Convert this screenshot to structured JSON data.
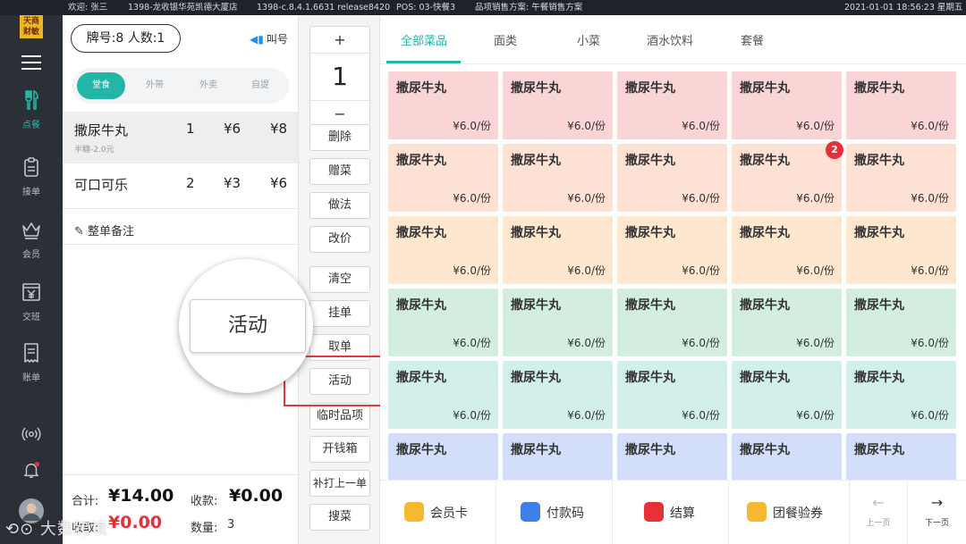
{
  "topbar": {
    "welcome": "欢迎: 张三",
    "store": "1398-龙收银华苑凯德大厦店",
    "version": "1398-c.8.4.1.6631 release8420",
    "pos": "POS: 03-快餐3",
    "plan": "品项销售方案: 午餐销售方案",
    "datetime": "2021-01-01  18:56:23  星期五"
  },
  "brand": {
    "logo_top": "天商",
    "logo_bottom": "财敏"
  },
  "rail": {
    "items": [
      {
        "label": "点餐",
        "icon": "fork-knife-icon",
        "active": true
      },
      {
        "label": "接单",
        "icon": "clipboard-icon",
        "active": false
      },
      {
        "label": "会员",
        "icon": "crown-icon",
        "active": false
      },
      {
        "label": "交班",
        "icon": "yen-register-icon",
        "active": false
      },
      {
        "label": "账单",
        "icon": "bill-icon",
        "active": false
      }
    ]
  },
  "order": {
    "table_info": "牌号:8   人数:1",
    "call_label": "叫号",
    "modes": [
      "堂食",
      "外带",
      "外卖",
      "自提"
    ],
    "selected_mode": "堂食",
    "lines": [
      {
        "name": "撒尿牛丸",
        "qty": "1",
        "price": "¥6",
        "total": "¥8",
        "note": "半糖-2.0元"
      },
      {
        "name": "可口可乐",
        "qty": "2",
        "price": "¥3",
        "total": "¥6",
        "note": ""
      }
    ],
    "whole_note": "整单备注",
    "totals": {
      "sum_label": "合计:",
      "sum_value": "¥14.00",
      "received_label": "收款:",
      "received_value": "¥0.00",
      "due_label": "收取:",
      "due_value": "¥0.00",
      "qty_label": "数量:",
      "qty_value": "3"
    }
  },
  "magnifier": {
    "label": "活动"
  },
  "actions": {
    "plus": "+",
    "quantity": "1",
    "minus": "−",
    "buttons": [
      "删除",
      "赠菜",
      "做法",
      "改价",
      "清空",
      "挂单",
      "取单",
      "活动",
      "临时品项",
      "开钱箱",
      "补打上一单",
      "搜菜"
    ],
    "highlighted": "活动"
  },
  "menu": {
    "tabs": [
      "全部菜品",
      "面类",
      "小菜",
      "酒水饮料",
      "套餐"
    ],
    "selected_tab": "全部菜品",
    "row_colors": [
      "#f9d5d5",
      "#fde1d4",
      "#fde7cf",
      "#d3eedf",
      "#d3efeb",
      "#d3defa"
    ],
    "badge_count": "2",
    "dishes": [
      [
        {
          "name": "撒尿牛丸",
          "price": "¥6.0/份"
        },
        {
          "name": "撒尿牛丸",
          "price": "¥6.0/份"
        },
        {
          "name": "撒尿牛丸",
          "price": "¥6.0/份"
        },
        {
          "name": "撒尿牛丸",
          "price": "¥6.0/份"
        },
        {
          "name": "撒尿牛丸",
          "price": "¥6.0/份"
        }
      ],
      [
        {
          "name": "撒尿牛丸",
          "price": "¥6.0/份"
        },
        {
          "name": "撒尿牛丸",
          "price": "¥6.0/份"
        },
        {
          "name": "撒尿牛丸",
          "price": "¥6.0/份"
        },
        {
          "name": "撒尿牛丸",
          "price": "¥6.0/份"
        },
        {
          "name": "撒尿牛丸",
          "price": "¥6.0/份"
        }
      ],
      [
        {
          "name": "撒尿牛丸",
          "price": "¥6.0/份"
        },
        {
          "name": "撒尿牛丸",
          "price": "¥6.0/份"
        },
        {
          "name": "撒尿牛丸",
          "price": "¥6.0/份"
        },
        {
          "name": "撒尿牛丸",
          "price": "¥6.0/份"
        },
        {
          "name": "撒尿牛丸",
          "price": "¥6.0/份"
        }
      ],
      [
        {
          "name": "撒尿牛丸",
          "price": "¥6.0/份"
        },
        {
          "name": "撒尿牛丸",
          "price": "¥6.0/份"
        },
        {
          "name": "撒尿牛丸",
          "price": "¥6.0/份"
        },
        {
          "name": "撒尿牛丸",
          "price": "¥6.0/份"
        },
        {
          "name": "撒尿牛丸",
          "price": "¥6.0/份"
        }
      ],
      [
        {
          "name": "撒尿牛丸",
          "price": "¥6.0/份"
        },
        {
          "name": "撒尿牛丸",
          "price": "¥6.0/份"
        },
        {
          "name": "撒尿牛丸",
          "price": "¥6.0/份"
        },
        {
          "name": "撒尿牛丸",
          "price": "¥6.0/份"
        },
        {
          "name": "撒尿牛丸",
          "price": "¥6.0/份"
        }
      ],
      [
        {
          "name": "撒尿牛丸",
          "price": ""
        },
        {
          "name": "撒尿牛丸",
          "price": ""
        },
        {
          "name": "撒尿牛丸",
          "price": ""
        },
        {
          "name": "撒尿牛丸",
          "price": ""
        },
        {
          "name": "撒尿牛丸",
          "price": ""
        }
      ]
    ],
    "bottom": [
      {
        "label": "会员卡",
        "icon": "member-card-icon",
        "color": "#f5b82e"
      },
      {
        "label": "付款码",
        "icon": "barcode-icon",
        "color": "#3d7fe8"
      },
      {
        "label": "结算",
        "icon": "wallet-icon",
        "color": "#e8303a"
      },
      {
        "label": "团餐验券",
        "icon": "coupon-icon",
        "color": "#f5b82e"
      }
    ],
    "prev_label": "上一页",
    "next_label": "下一页"
  },
  "watermark": "大数跨境",
  "accent": "#21b6a8"
}
